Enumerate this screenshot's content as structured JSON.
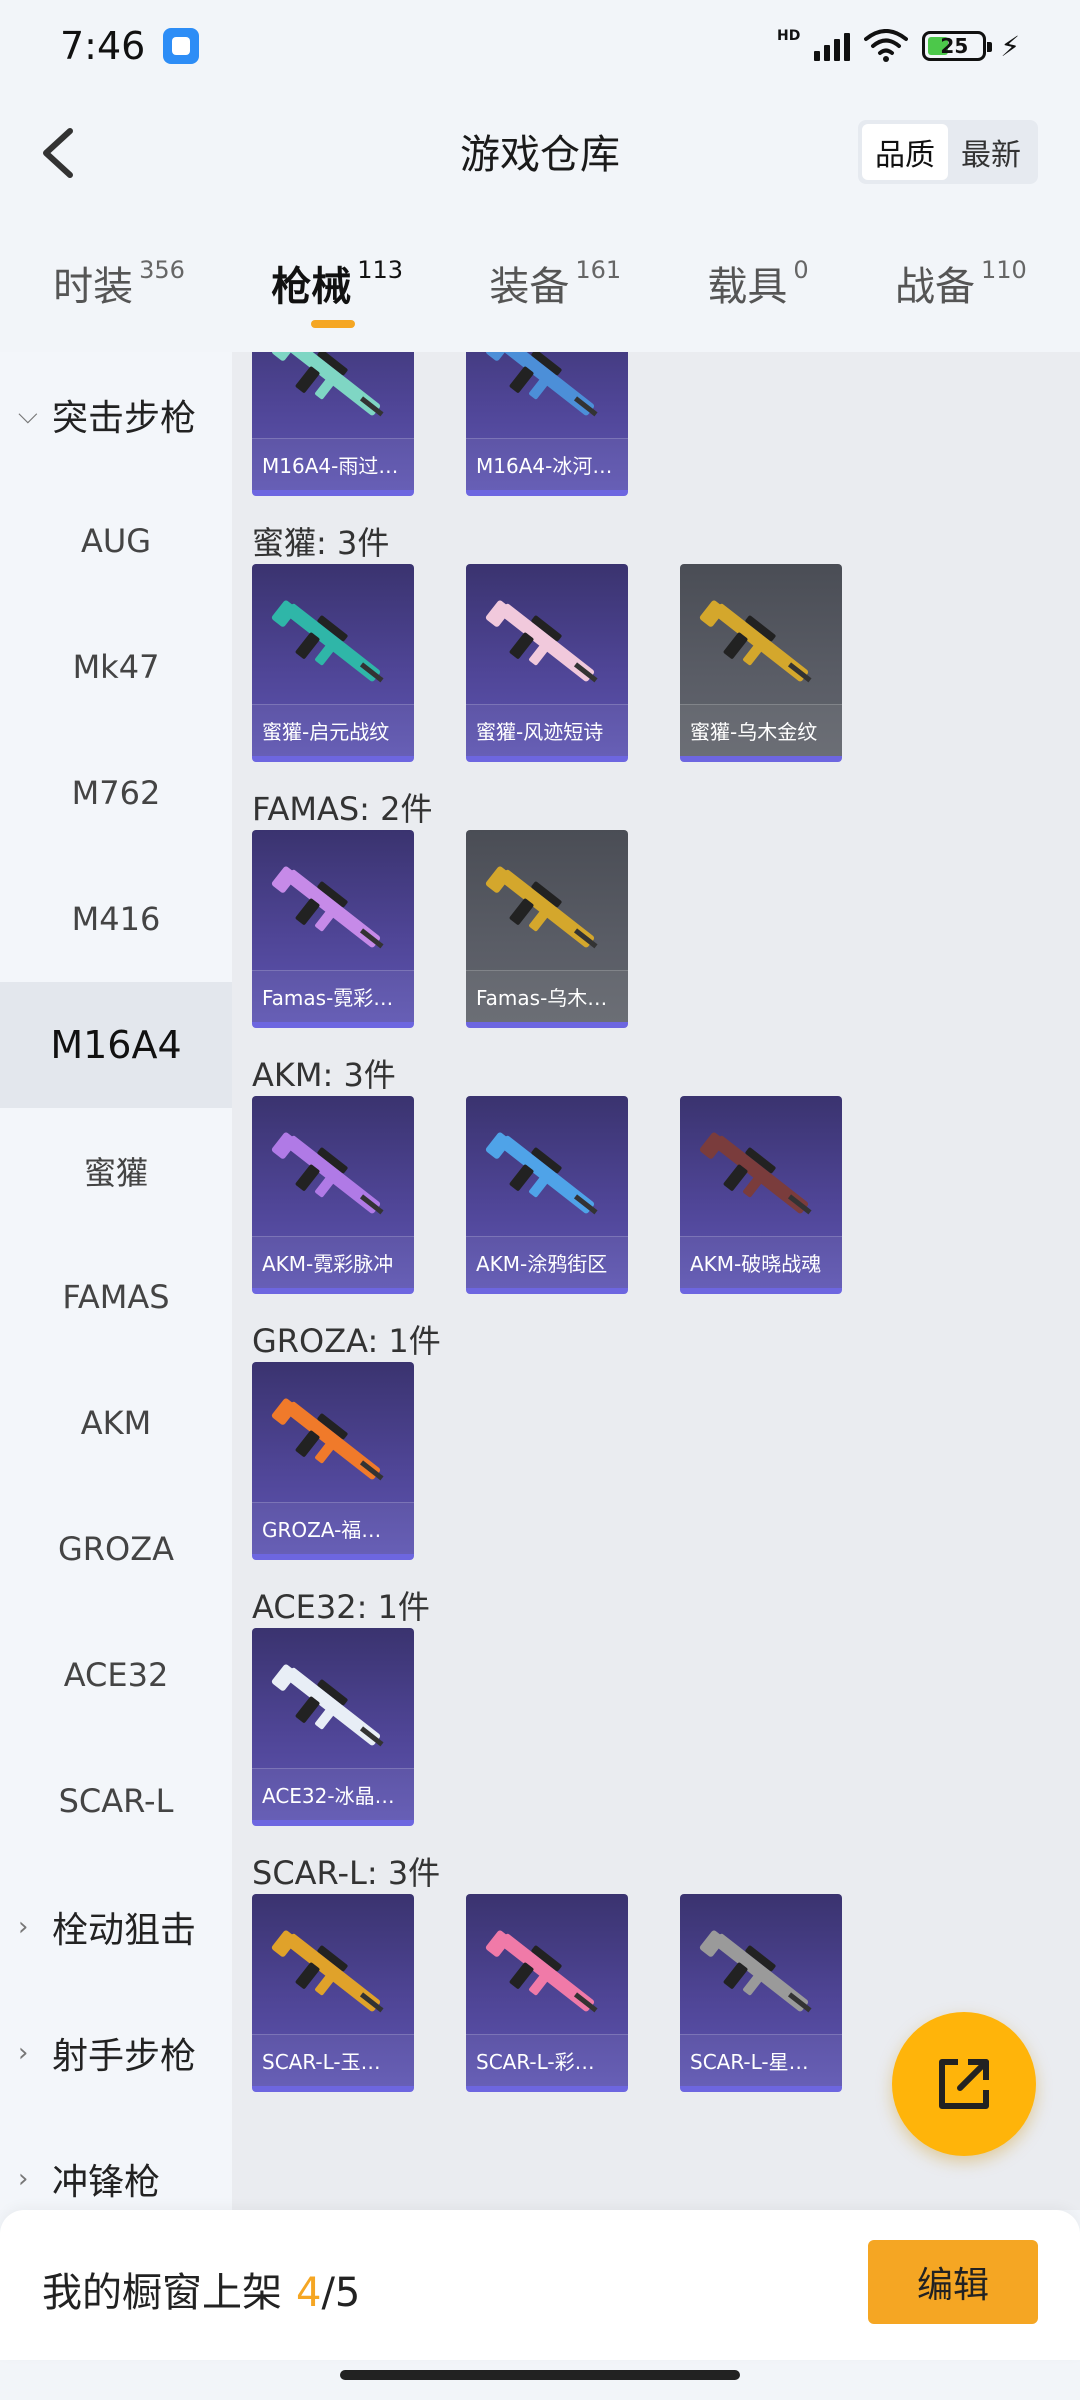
{
  "status_bar": {
    "time": "7:46",
    "network_label": "HD",
    "battery_level": "25"
  },
  "header": {
    "title": "游戏仓库",
    "sort_options": [
      "品质",
      "最新"
    ],
    "active_sort": "品质"
  },
  "category_tabs": [
    {
      "label": "时装",
      "count": "356"
    },
    {
      "label": "枪械",
      "count": "113",
      "active": true
    },
    {
      "label": "装备",
      "count": "161"
    },
    {
      "label": "载具",
      "count": "0"
    },
    {
      "label": "战备",
      "count": "110"
    }
  ],
  "sidebar": {
    "items": [
      {
        "label": "突击步枪",
        "group": true,
        "expanded": true
      },
      {
        "label": "AUG"
      },
      {
        "label": "Mk47"
      },
      {
        "label": "M762"
      },
      {
        "label": "M416"
      },
      {
        "label": "M16A4",
        "active": true
      },
      {
        "label": "蜜獾"
      },
      {
        "label": "FAMAS"
      },
      {
        "label": "AKM"
      },
      {
        "label": "GROZA"
      },
      {
        "label": "ACE32"
      },
      {
        "label": "SCAR-L"
      },
      {
        "label": "栓动狙击",
        "group": true
      },
      {
        "label": "射手步枪",
        "group": true
      },
      {
        "label": "冲锋枪",
        "group": true
      }
    ]
  },
  "groups": [
    {
      "title": "",
      "items": [
        {
          "name": "M16A4-雨过…",
          "color": "#7fd6c4"
        },
        {
          "name": "M16A4-冰河…",
          "color": "#4c8fd8"
        }
      ]
    },
    {
      "title": "蜜獾: 3件",
      "items": [
        {
          "name": "蜜獾-启元战纹",
          "color": "#2fb6a8"
        },
        {
          "name": "蜜獾-风迹短诗",
          "color": "#f1c9dc"
        },
        {
          "name": "蜜獾-乌木金纹",
          "color": "#d4a72c",
          "gray": true
        }
      ]
    },
    {
      "title": "FAMAS: 2件",
      "items": [
        {
          "name": "Famas-霓彩…",
          "color": "#c68ae8"
        },
        {
          "name": "Famas-乌木…",
          "color": "#d4a72c",
          "gray": true
        }
      ]
    },
    {
      "title": "AKM: 3件",
      "items": [
        {
          "name": "AKM-霓彩脉冲",
          "color": "#b07ae6"
        },
        {
          "name": "AKM-涂鸦街区",
          "color": "#4fa3e8"
        },
        {
          "name": "AKM-破晓战魂",
          "color": "#7a3c3c"
        }
      ]
    },
    {
      "title": "GROZA: 1件",
      "items": [
        {
          "name": "GROZA-福…",
          "color": "#f07a2a"
        }
      ]
    },
    {
      "title": "ACE32: 1件",
      "items": [
        {
          "name": "ACE32-冰晶…",
          "color": "#e8eef6"
        }
      ]
    },
    {
      "title": "SCAR-L: 3件",
      "items": [
        {
          "name": "SCAR-L-玉…",
          "color": "#e0a22a"
        },
        {
          "name": "SCAR-L-彩…",
          "color": "#f07aa8"
        },
        {
          "name": "SCAR-L-星…",
          "color": "#9a9a9a"
        }
      ]
    }
  ],
  "showcase": {
    "label": "我的橱窗上架",
    "current": "4",
    "total": "/5",
    "edit_label": "编辑"
  },
  "colors": {
    "accent": "#f5a623",
    "fab": "#ffb40a",
    "card_border": "#6d66e0"
  }
}
